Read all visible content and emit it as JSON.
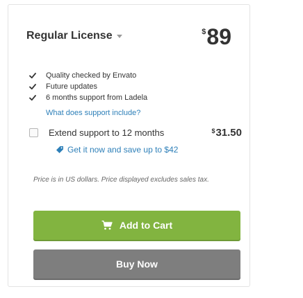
{
  "license": {
    "title": "Regular License",
    "currency": "$",
    "price": "89"
  },
  "features": [
    "Quality checked by Envato",
    "Future updates",
    "6 months support from Ladela"
  ],
  "support_link": "What does support include?",
  "extend": {
    "label": "Extend support to 12 months",
    "currency": "$",
    "price": "31.50",
    "checked": false,
    "save_text": "Get it now and save up to $42"
  },
  "disclaimer": "Price is in US dollars. Price displayed excludes sales tax.",
  "buttons": {
    "add_to_cart": "Add to Cart",
    "buy_now": "Buy Now"
  },
  "colors": {
    "cart_button": "#82b440",
    "buy_button": "#7e7e7e",
    "link": "#2d7fb8"
  },
  "icons": {
    "check": "check-icon",
    "tag": "tag-icon",
    "cart": "cart-icon",
    "caret": "chevron-down-icon"
  }
}
